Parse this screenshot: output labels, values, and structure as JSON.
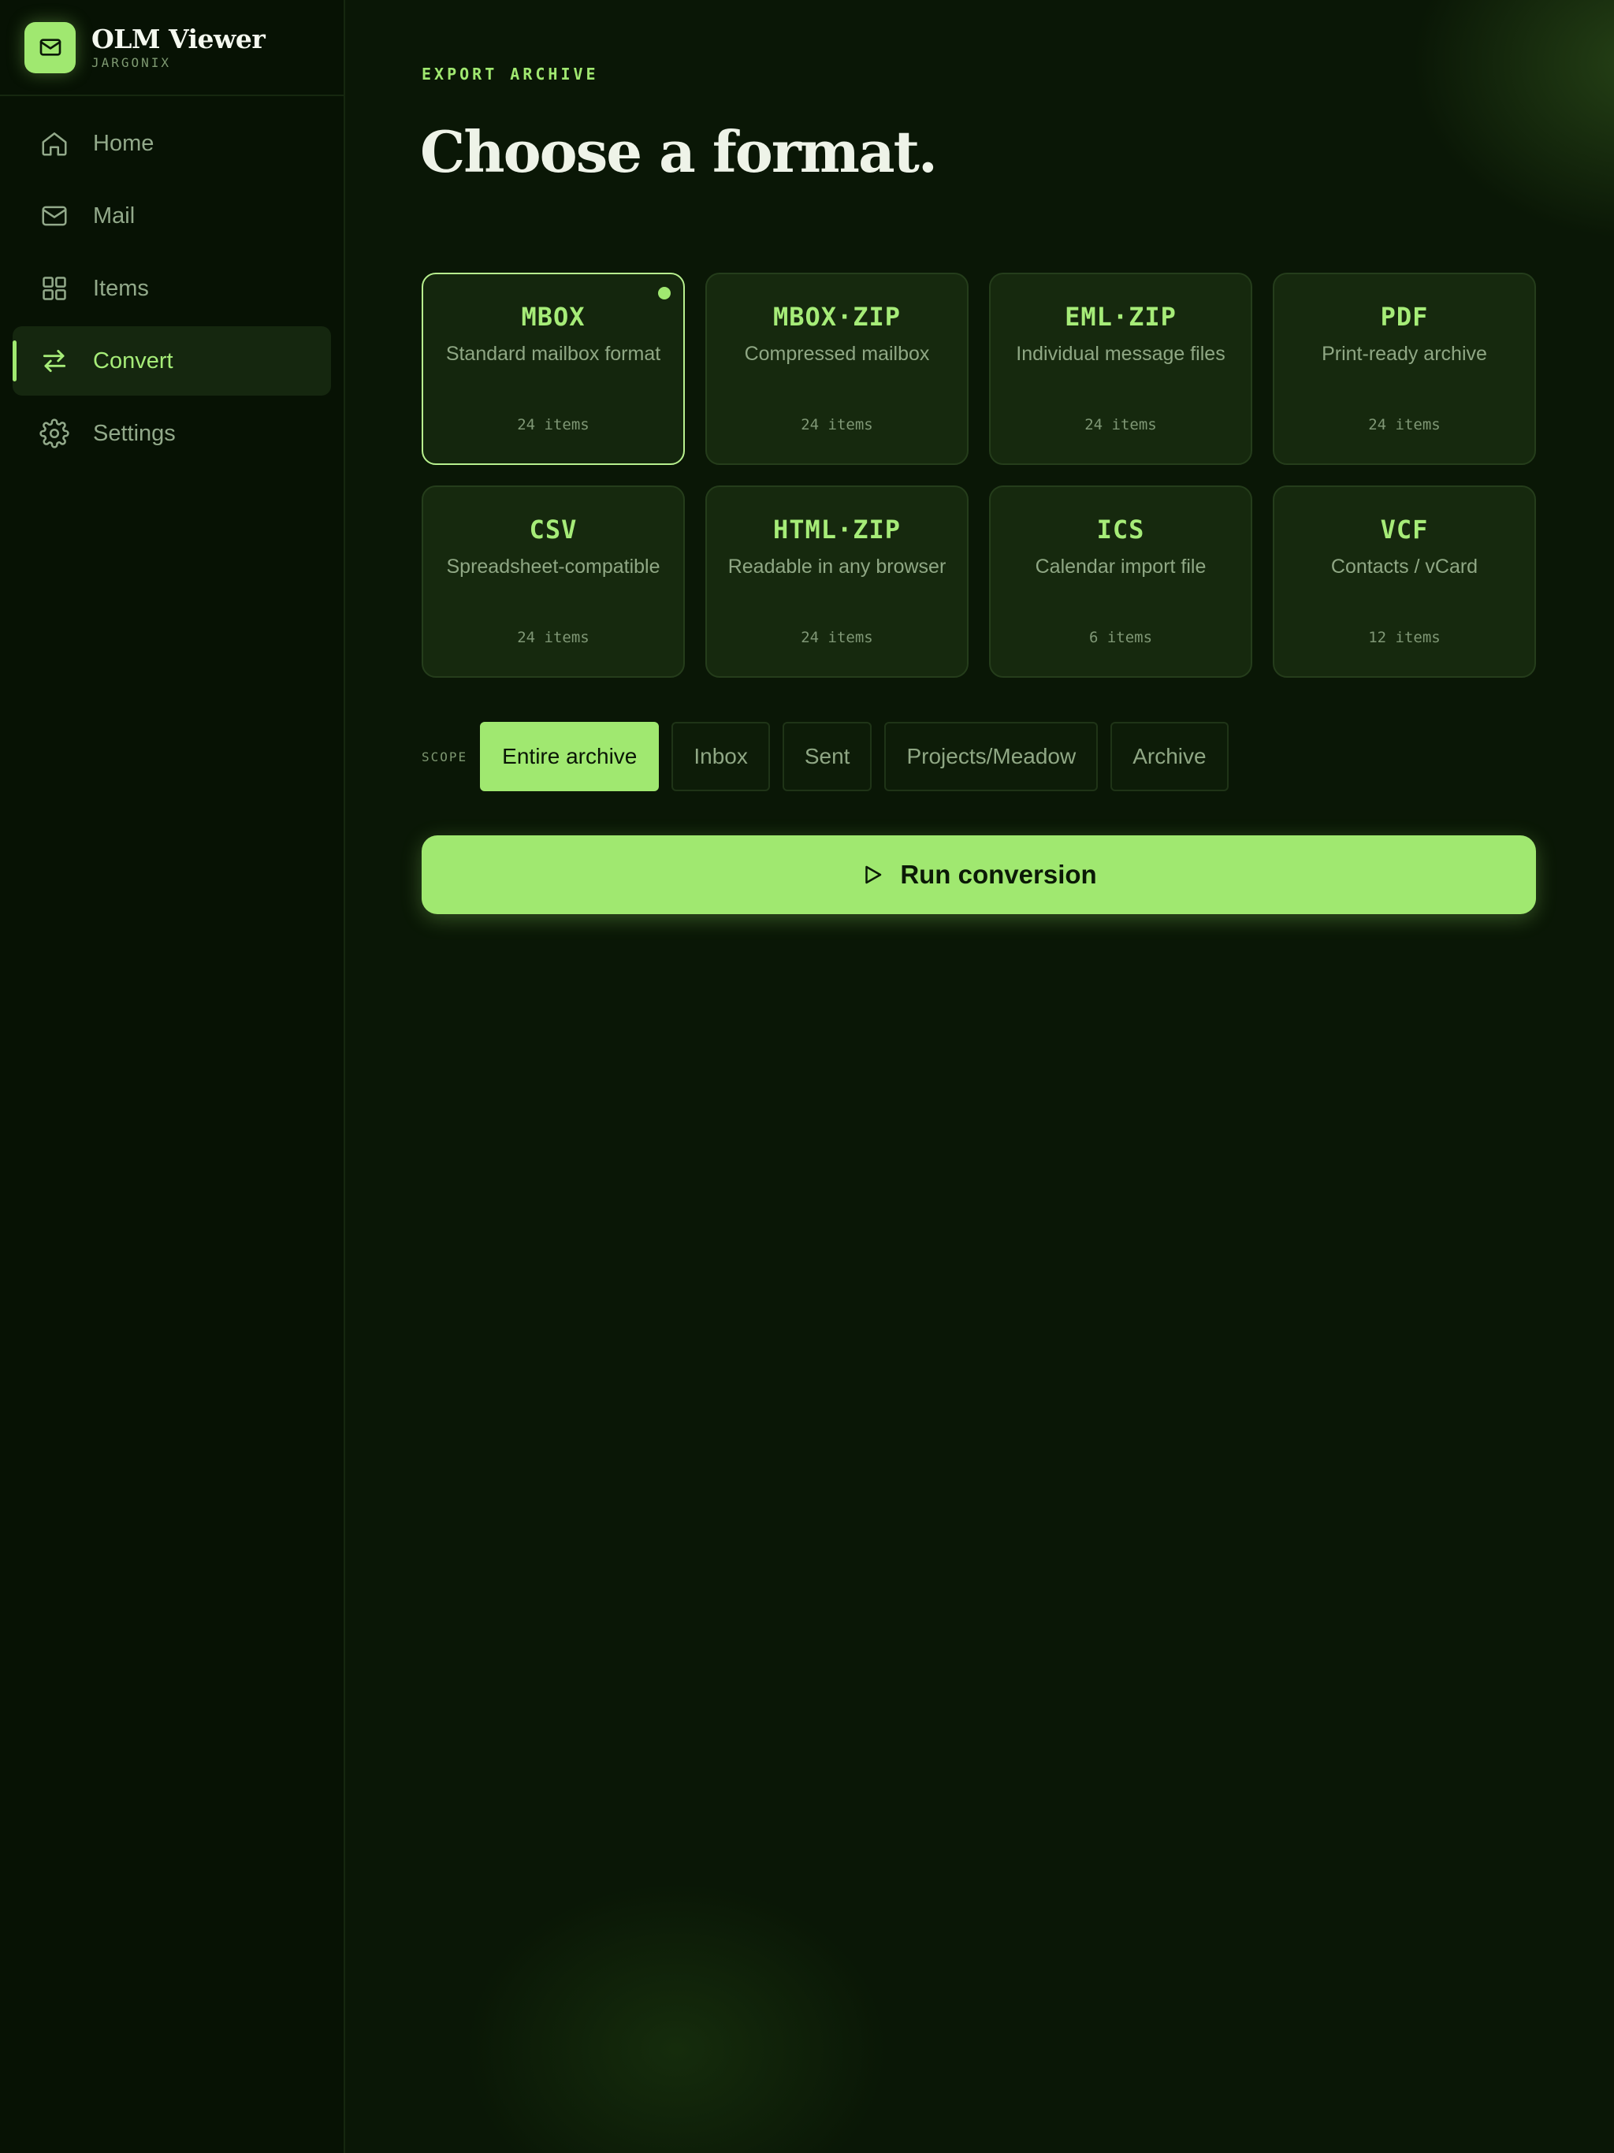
{
  "brand": {
    "name": "OLM Viewer",
    "subtitle": "JARGONIX",
    "icon": "mail-icon"
  },
  "sidebar": {
    "items": [
      {
        "label": "Home",
        "icon": "home-icon",
        "active": false
      },
      {
        "label": "Mail",
        "icon": "mail-icon",
        "active": false
      },
      {
        "label": "Items",
        "icon": "grid-icon",
        "active": false
      },
      {
        "label": "Convert",
        "icon": "swap-arrows-icon",
        "active": true
      },
      {
        "label": "Settings",
        "icon": "gear-icon",
        "active": false
      }
    ]
  },
  "main": {
    "eyebrow": "EXPORT ARCHIVE",
    "title": "Choose a format.",
    "formats": [
      {
        "title": "MBOX",
        "desc": "Standard mailbox format",
        "count": "24 items",
        "selected": true
      },
      {
        "title": "MBOX·ZIP",
        "desc": "Compressed mailbox",
        "count": "24 items",
        "selected": false
      },
      {
        "title": "EML·ZIP",
        "desc": "Individual message files",
        "count": "24 items",
        "selected": false
      },
      {
        "title": "PDF",
        "desc": "Print-ready archive",
        "count": "24 items",
        "selected": false
      },
      {
        "title": "CSV",
        "desc": "Spreadsheet-compatible",
        "count": "24 items",
        "selected": false
      },
      {
        "title": "HTML·ZIP",
        "desc": "Readable in any browser",
        "count": "24 items",
        "selected": false
      },
      {
        "title": "ICS",
        "desc": "Calendar import file",
        "count": "6 items",
        "selected": false
      },
      {
        "title": "VCF",
        "desc": "Contacts / vCard",
        "count": "12 items",
        "selected": false
      }
    ],
    "scope": {
      "label": "SCOPE",
      "options": [
        "Entire archive",
        "Inbox",
        "Sent",
        "Projects/Meadow",
        "Archive"
      ],
      "selected": "Entire archive"
    },
    "run_button": {
      "label": "Run conversion",
      "icon": "play-icon"
    }
  },
  "colors": {
    "accent": "#a0e870",
    "background": "#0a1706",
    "sidebar": "#071204",
    "card": "#16290e"
  }
}
